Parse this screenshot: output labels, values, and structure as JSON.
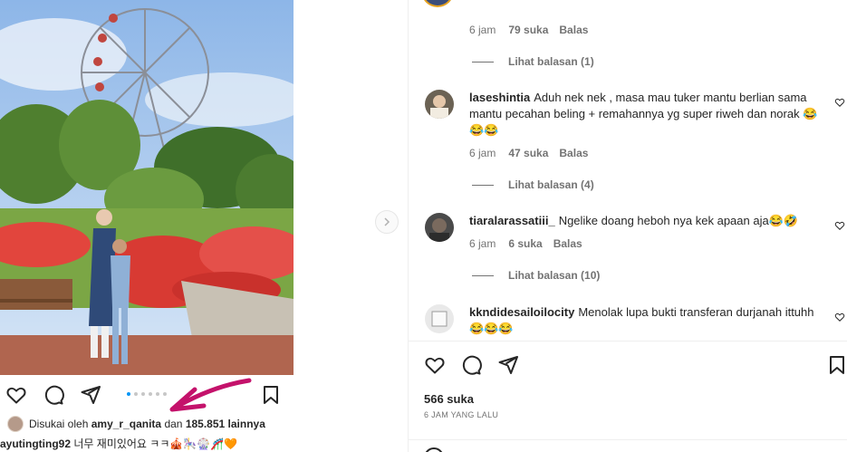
{
  "feed": {
    "liked_prefix": "Disukai oleh",
    "liked_user": "amy_r_qanita",
    "liked_and": "dan",
    "liked_count": "185.851 lainnya",
    "caption_user": "ayutingting92",
    "caption_text": "너무 재미있어요 ㅋㅋ🎪🎠🎡🎢🧡",
    "carousel": {
      "total": 6,
      "active": 1
    }
  },
  "panel": {
    "comments": [
      {
        "id": "c0",
        "time": "6 jam",
        "likes": "79 suka",
        "reply": "Balas",
        "view_replies": "Lihat balasan (1)"
      },
      {
        "id": "c1",
        "user": "laseshintia",
        "text": "Aduh nek nek , masa mau tuker mantu berlian sama mantu pecahan beling + remahannya yg super riweh dan norak 😂😂😂",
        "time": "6 jam",
        "likes": "47 suka",
        "reply": "Balas",
        "view_replies": "Lihat balasan (4)"
      },
      {
        "id": "c2",
        "user": "tiaralarassatiii_",
        "text": "Ngelike doang heboh nya kek apaan aja😂🤣",
        "time": "6 jam",
        "likes": "6 suka",
        "reply": "Balas",
        "view_replies": "Lihat balasan (10)"
      },
      {
        "id": "c3",
        "user": "kkndidesailoilocity",
        "text": "Menolak lupa bukti transferan durjanah ittuhh 😂😂😂"
      }
    ],
    "likes_total": "566 suka",
    "time_ago": "6 JAM YANG LALU"
  },
  "colors": {
    "accent_blue": "#0095f6",
    "annotation": "#c4126b",
    "muted": "#737373"
  }
}
